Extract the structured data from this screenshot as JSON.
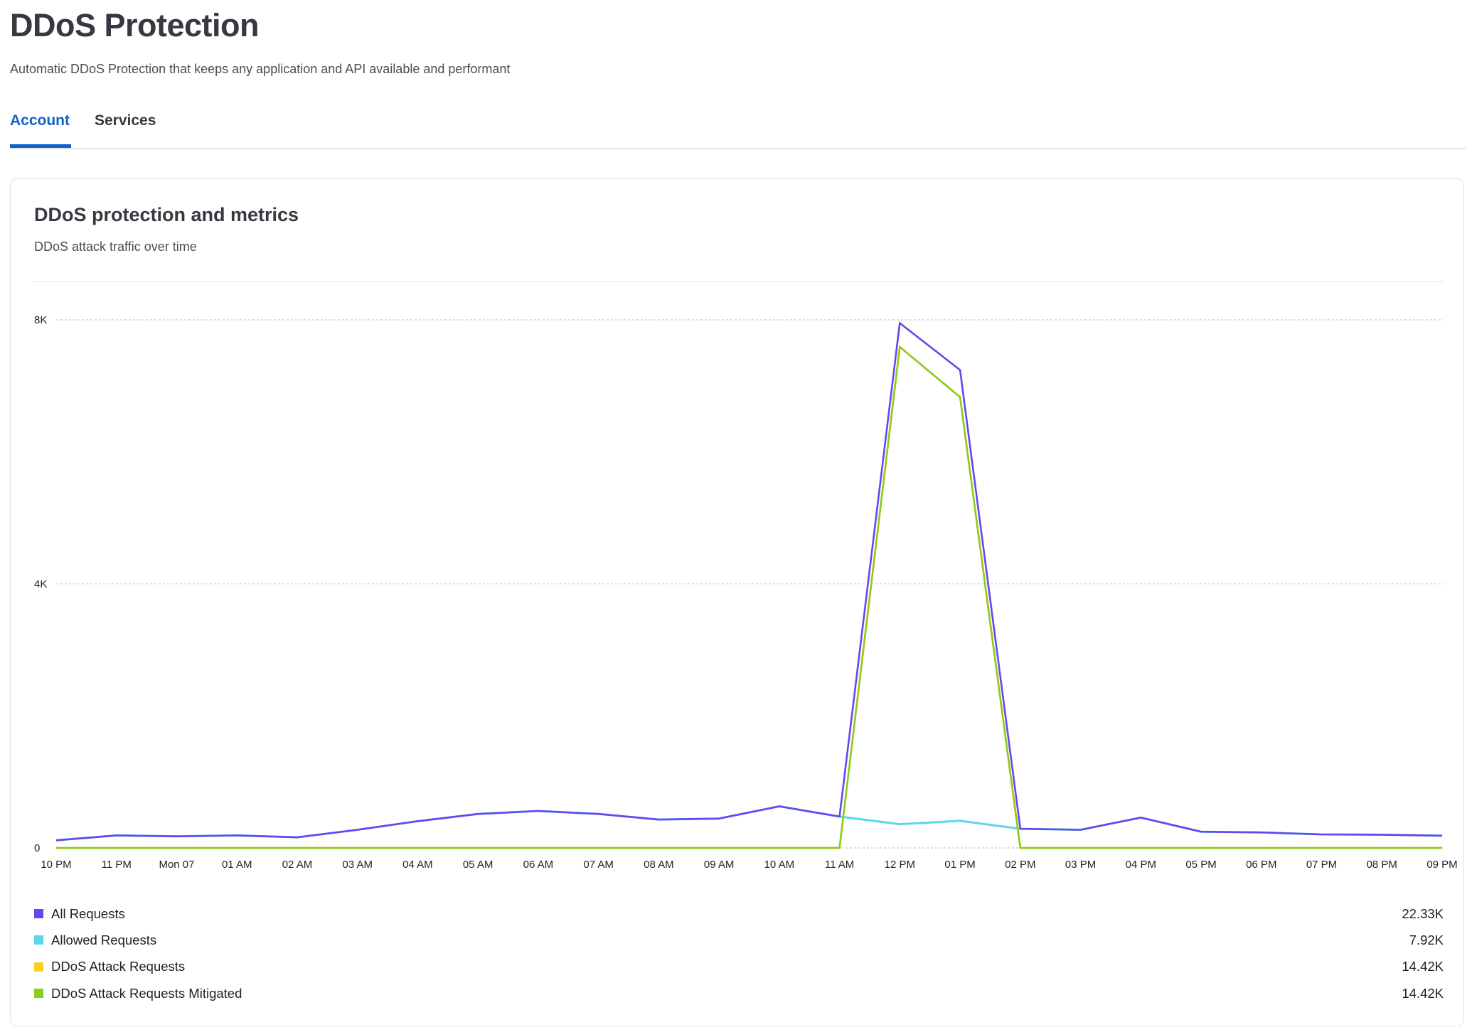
{
  "header": {
    "title": "DDoS Protection",
    "subtitle": "Automatic DDoS Protection that keeps any application and API available and performant"
  },
  "tabs": [
    {
      "label": "Account",
      "active": true
    },
    {
      "label": "Services",
      "active": false
    }
  ],
  "card": {
    "title": "DDoS protection and metrics",
    "subtitle": "DDoS attack traffic over time"
  },
  "colors": {
    "accent": "#0f62c9",
    "all_requests": "#6745f2",
    "allowed_requests": "#5ad8ea",
    "ddos_attack_requests": "#fbd11d",
    "ddos_attack_requests_mitigated": "#8fcb1a"
  },
  "legend": [
    {
      "label": "All Requests",
      "value": "22.33K",
      "color": "#6745f2"
    },
    {
      "label": "Allowed Requests",
      "value": "7.92K",
      "color": "#5ad8ea"
    },
    {
      "label": "DDoS Attack Requests",
      "value": "14.42K",
      "color": "#fbd11d"
    },
    {
      "label": "DDoS Attack Requests Mitigated",
      "value": "14.42K",
      "color": "#8fcb1a"
    }
  ],
  "chart_data": {
    "type": "line",
    "title": "DDoS attack traffic over time",
    "xlabel": "",
    "ylabel": "",
    "x": [
      "10 PM",
      "11 PM",
      "Mon 07",
      "01 AM",
      "02 AM",
      "03 AM",
      "04 AM",
      "05 AM",
      "06 AM",
      "07 AM",
      "08 AM",
      "09 AM",
      "10 AM",
      "11 AM",
      "12 PM",
      "01 PM",
      "02 PM",
      "03 PM",
      "04 PM",
      "05 PM",
      "06 PM",
      "07 PM",
      "08 PM",
      "09 PM"
    ],
    "ylim": [
      0,
      8000
    ],
    "yticks": [
      0,
      4000,
      8000
    ],
    "ytick_labels": [
      "0",
      "4K",
      "8K"
    ],
    "grid": "horizontal-dotted",
    "legend_position": "bottom",
    "series": [
      {
        "name": "All Requests",
        "color": "#6745f2",
        "values": [
          115,
          190,
          175,
          190,
          160,
          275,
          405,
          515,
          560,
          515,
          430,
          445,
          630,
          475,
          7950,
          7240,
          290,
          275,
          460,
          245,
          235,
          205,
          200,
          185
        ]
      },
      {
        "name": "Allowed Requests",
        "color": "#5ad8ea",
        "values": [
          115,
          190,
          175,
          190,
          160,
          275,
          405,
          515,
          560,
          515,
          430,
          445,
          630,
          475,
          360,
          410,
          290,
          275,
          460,
          245,
          235,
          205,
          200,
          185
        ]
      },
      {
        "name": "DDoS Attack Requests",
        "color": "#fbd11d",
        "values": [
          0,
          0,
          0,
          0,
          0,
          0,
          0,
          0,
          0,
          0,
          0,
          0,
          0,
          0,
          7590,
          6830,
          0,
          0,
          0,
          0,
          0,
          0,
          0,
          0
        ]
      },
      {
        "name": "DDoS Attack Requests Mitigated",
        "color": "#8fcb1a",
        "values": [
          0,
          0,
          0,
          0,
          0,
          0,
          0,
          0,
          0,
          0,
          0,
          0,
          0,
          0,
          7590,
          6830,
          0,
          0,
          0,
          0,
          0,
          0,
          0,
          0
        ]
      }
    ],
    "totals": {
      "All Requests": "22.33K",
      "Allowed Requests": "7.92K",
      "DDoS Attack Requests": "14.42K",
      "DDoS Attack Requests Mitigated": "14.42K"
    }
  }
}
